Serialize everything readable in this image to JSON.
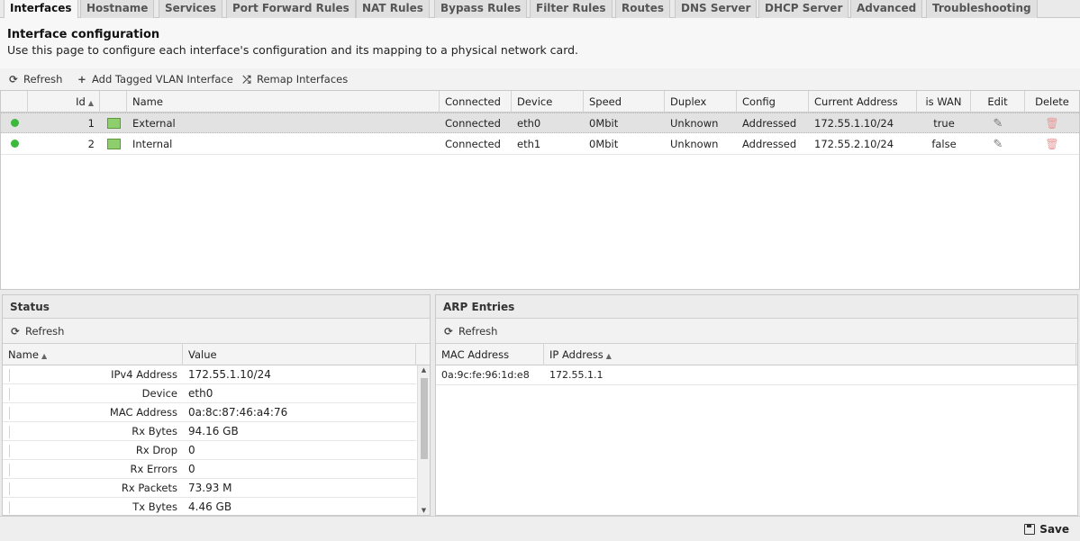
{
  "tabs": [
    "Interfaces",
    "Hostname",
    "Services",
    "Port Forward Rules",
    "NAT Rules",
    "Bypass Rules",
    "Filter Rules",
    "Routes",
    "DNS Server",
    "DHCP Server",
    "Advanced",
    "Troubleshooting"
  ],
  "active_tab": "Interfaces",
  "header": {
    "title": "Interface configuration",
    "description": "Use this page to configure each interface's configuration and its mapping to a physical network card."
  },
  "toolbar": {
    "refresh": "Refresh",
    "add_vlan": "Add Tagged VLAN Interface",
    "remap": "Remap Interfaces"
  },
  "interfaces": {
    "columns": [
      "Id",
      "Name",
      "Connected",
      "Device",
      "Speed",
      "Duplex",
      "Config",
      "Current Address",
      "is WAN",
      "Edit",
      "Delete"
    ],
    "rows": [
      {
        "id": "1",
        "name": "External",
        "connected": "Connected",
        "device": "eth0",
        "speed": "0Mbit",
        "duplex": "Unknown",
        "config": "Addressed",
        "address": "172.55.1.10/24",
        "is_wan": "true"
      },
      {
        "id": "2",
        "name": "Internal",
        "connected": "Connected",
        "device": "eth1",
        "speed": "0Mbit",
        "duplex": "Unknown",
        "config": "Addressed",
        "address": "172.55.2.10/24",
        "is_wan": "false"
      }
    ]
  },
  "status": {
    "title": "Status",
    "refresh": "Refresh",
    "columns": [
      "Name",
      "Value"
    ],
    "rows": [
      {
        "name": "IPv4 Address",
        "value": "172.55.1.10/24"
      },
      {
        "name": "Device",
        "value": "eth0"
      },
      {
        "name": "MAC Address",
        "value": "0a:8c:87:46:a4:76"
      },
      {
        "name": "Rx Bytes",
        "value": "94.16 GB"
      },
      {
        "name": "Rx Drop",
        "value": "0"
      },
      {
        "name": "Rx Errors",
        "value": "0"
      },
      {
        "name": "Rx Packets",
        "value": "73.93 M"
      },
      {
        "name": "Tx Bytes",
        "value": "4.46 GB"
      }
    ]
  },
  "arp": {
    "title": "ARP Entries",
    "refresh": "Refresh",
    "columns": [
      "MAC Address",
      "IP Address"
    ],
    "rows": [
      {
        "mac": "0a:9c:fe:96:1d:e8",
        "ip": "172.55.1.1"
      }
    ]
  },
  "footer": {
    "save": "Save"
  },
  "colors": {
    "status_dot": "#3cb83c",
    "nic_icon": "#8fce6c",
    "delete_icon": "#e79a9a"
  },
  "icons": {
    "refresh": "refresh-icon",
    "add": "plus-icon",
    "remap": "shuffle-icon",
    "edit": "pencil-icon",
    "delete": "trash-icon",
    "save": "floppy-icon"
  }
}
